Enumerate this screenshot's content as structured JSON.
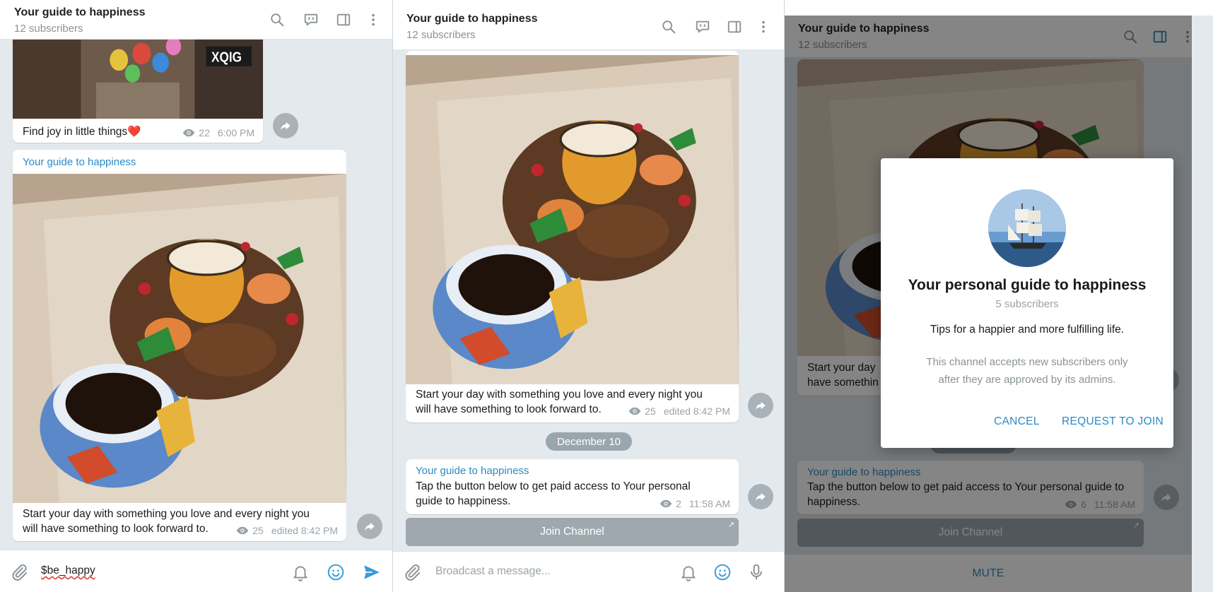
{
  "colors": {
    "accent": "#2d8ac4",
    "chat_background": "#e3e9ed",
    "send_icon": "#3a9ad9",
    "heart": "#d9232e"
  },
  "channel": {
    "title": "Your guide to happiness",
    "subscribers": "12 subscribers"
  },
  "header_icons": [
    "search-icon",
    "live-chat-icon",
    "sidebar-toggle-icon",
    "more-vertical-icon"
  ],
  "panel1": {
    "msg1": {
      "text": "Find joy in little things",
      "emoji": "❤️",
      "views": "22",
      "time": "6:00 PM"
    },
    "msg2": {
      "sender": "Your guide to happiness",
      "text_line1": "Start your day with something you love and every night you",
      "text_line2": "will have something to look forward to.",
      "views": "25",
      "time": "edited 8:42 PM"
    },
    "composer": {
      "value": "$be_happy"
    }
  },
  "panel2": {
    "msg1": {
      "text_line1": "Start your day with something you love and every night you",
      "text_line2": "will have something to look forward to.",
      "views": "25",
      "time": "edited 8:42 PM"
    },
    "date_separator": "December 10",
    "msg2": {
      "sender": "Your guide to happiness",
      "text_line1": "Tap the button below to get paid access to Your personal",
      "text_line2": "guide to happiness.",
      "views": "2",
      "time": "11:58 AM"
    },
    "join_button": "Join Channel",
    "composer": {
      "placeholder": "Broadcast a message..."
    }
  },
  "panel3": {
    "msg1": {
      "text_line1": "Start your day",
      "text_line2": "have somethin"
    },
    "msg2": {
      "sender": "Your guide to happiness",
      "text_line1": "Tap the button below to get paid access to Your personal guide to",
      "text_line2": "happiness.",
      "views": "6",
      "time": "11:58 AM"
    },
    "join_button": "Join Channel",
    "mute_button": "MUTE",
    "dialog": {
      "title": "Your personal guide to happiness",
      "subscribers": "5 subscribers",
      "description": "Tips for a happier and more fulfilling life.",
      "note_line1": "This channel accepts new subscribers only",
      "note_line2": "after they are approved by its admins.",
      "cancel": "CANCEL",
      "request": "REQUEST TO JOIN"
    }
  }
}
